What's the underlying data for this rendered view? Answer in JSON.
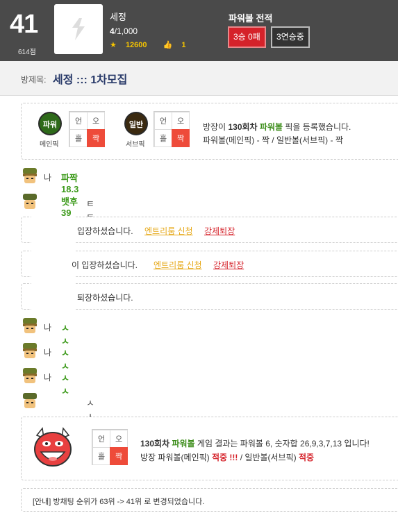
{
  "profile": {
    "rank": "41",
    "points": "614점",
    "name": "세정",
    "count_current": "4",
    "count_max": "/1,000",
    "coins": "12600",
    "likes": "1"
  },
  "record": {
    "title": "파워볼 전적",
    "result": "3승 0패",
    "streak": "3연승중"
  },
  "room": {
    "label": "방제목:",
    "title": "세정 ::: 1차모집"
  },
  "pick": {
    "main_ball": "파워볼",
    "main_caption": "메인픽",
    "sub_ball": "일반볼",
    "sub_caption": "서브픽",
    "grid": [
      "언",
      "오",
      "홀",
      "짝"
    ],
    "line1_pre": "방장이 ",
    "round": "130회차",
    "game": "파워볼",
    "line1_post": " 픽을 등록했습니다.",
    "line2": "파워볼(메인픽) - 짝 / 일반볼(서브픽) - 짝"
  },
  "chats": [
    {
      "name": "나",
      "text": "파짝18.3 뱃후39"
    },
    {
      "name": "",
      "text": "ㅌㅌ"
    },
    {
      "name": "나",
      "text": "ㅅㅅ"
    },
    {
      "name": "나",
      "text": "ㅅㅅ"
    },
    {
      "name": "나",
      "text": "ㅅㅅ"
    },
    {
      "name": "",
      "text": "ㅅㅅㅅㅅㅅ"
    }
  ],
  "notices": [
    {
      "text": "입장하셨습니다.",
      "link1": "엔트리룸 신청",
      "link2": "강제퇴장"
    },
    {
      "text": "이 입장하셨습니다.",
      "link1": "엔트리룸 신청",
      "link2": "강제퇴장"
    },
    {
      "text": "퇴장하셨습니다."
    }
  ],
  "result": {
    "round": "130회차",
    "game": "파워볼",
    "line1_mid": " 게임 결과는 파워볼 6, 숫자합 26,9,3,7,13 입니다!",
    "line2_pre": "방장 파워볼(메인픽) ",
    "hit1": "적중 !!!",
    "line2_mid": " / 일반볼(서브픽) ",
    "hit2": "적중"
  },
  "info": "[안내] 방채팅 순위가 63위 -> 41위 로 변경되었습니다.",
  "colors": {
    "accent_red": "#d5222a",
    "pick_green": "#3c8d1a",
    "link_yellow": "#e6a817",
    "header_bg": "#4a4a4a"
  }
}
